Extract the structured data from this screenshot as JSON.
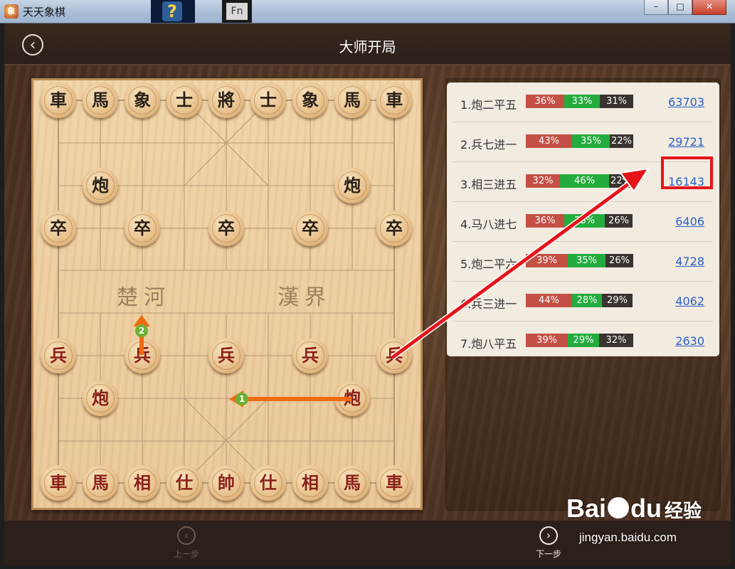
{
  "window": {
    "title": "天天象棋",
    "icon_glyph": "象",
    "taskbar_glyph_1": "?",
    "taskbar_glyph_2": "Fn",
    "buttons": {
      "minimize": "–",
      "maximize": "□",
      "close": "✕"
    }
  },
  "header": {
    "title": "大师开局",
    "back_icon": "‹"
  },
  "board": {
    "river_left": "楚河",
    "river_right": "漢界",
    "black_back_rank": [
      "車",
      "馬",
      "象",
      "士",
      "將",
      "士",
      "象",
      "馬",
      "車"
    ],
    "black_cannons": [
      "炮",
      "炮"
    ],
    "black_soldiers": [
      "卒",
      "卒",
      "卒",
      "卒",
      "卒"
    ],
    "red_soldiers": [
      "兵",
      "兵",
      "兵",
      "兵",
      "兵"
    ],
    "red_cannons": [
      "炮",
      "炮"
    ],
    "red_back_rank": [
      "車",
      "馬",
      "相",
      "仕",
      "帥",
      "仕",
      "相",
      "馬",
      "車"
    ],
    "arrows": [
      {
        "badge": "1",
        "label": "move-arrow-1"
      },
      {
        "badge": "2",
        "label": "move-arrow-2"
      }
    ]
  },
  "openings": [
    {
      "name": "1.炮二平五",
      "red": "36%",
      "green": "33%",
      "dark": "31%",
      "r": 36,
      "g": 33,
      "d": 31,
      "count": "63703"
    },
    {
      "name": "2.兵七进一",
      "red": "43%",
      "green": "35%",
      "dark": "22%",
      "r": 43,
      "g": 35,
      "d": 22,
      "count": "29721"
    },
    {
      "name": "3.相三进五",
      "red": "32%",
      "green": "46%",
      "dark": "22%",
      "r": 32,
      "g": 46,
      "d": 22,
      "count": "16143"
    },
    {
      "name": "4.马八进七",
      "red": "36%",
      "green": "38%",
      "dark": "26%",
      "r": 36,
      "g": 38,
      "d": 26,
      "count": "6406"
    },
    {
      "name": "5.炮二平六",
      "red": "39%",
      "green": "35%",
      "dark": "26%",
      "r": 39,
      "g": 35,
      "d": 26,
      "count": "4728"
    },
    {
      "name": "6.兵三进一",
      "red": "44%",
      "green": "28%",
      "dark": "29%",
      "r": 44,
      "g": 28,
      "d": 29,
      "count": "4062"
    },
    {
      "name": "7.炮八平五",
      "red": "39%",
      "green": "29%",
      "dark": "32%",
      "r": 39,
      "g": 29,
      "d": 32,
      "count": "2630"
    }
  ],
  "footer": {
    "prev_label": "上一步",
    "next_label": "下一步",
    "prev_icon": "‹",
    "next_icon": "›"
  },
  "watermark": {
    "brand": "Bai",
    "brand_tail": "du",
    "cn": "经验",
    "url": "jingyan.baidu.com"
  },
  "colors": {
    "red_seg": "#c45045",
    "green_seg": "#23ac3d",
    "dark_seg": "#3a3430",
    "arrow": "#f06a12",
    "highlight": "#e5141a",
    "link": "#2d5fc6"
  }
}
